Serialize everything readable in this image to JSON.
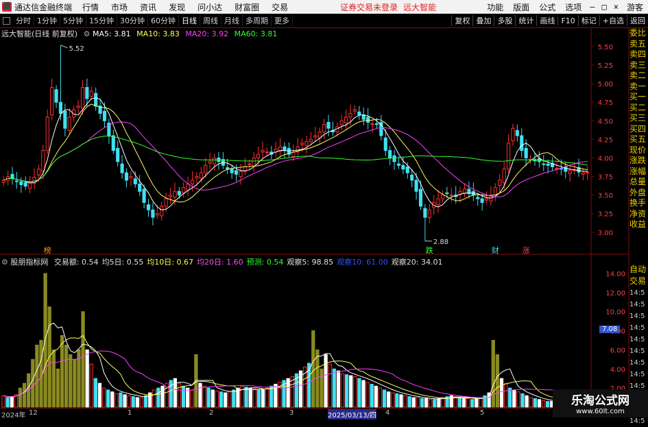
{
  "menubar": {
    "app_name": "通达信金融终端",
    "items": [
      "行情",
      "市场",
      "资讯",
      "发现",
      "问小达",
      "财富圈",
      "交易"
    ],
    "warning": "证券交易未登录",
    "stock_name": "远大智能",
    "right_items": [
      "功能",
      "版面",
      "公式",
      "选项"
    ],
    "user": "游客"
  },
  "toolbar": {
    "periods": [
      "分时",
      "1分钟",
      "5分钟",
      "15分钟",
      "30分钟",
      "60分钟",
      "日线",
      "周线",
      "月线",
      "多周期",
      "更多"
    ],
    "active_period": "日线",
    "right_buttons": [
      "复权",
      "叠加",
      "多股",
      "统计",
      "画线",
      "F10",
      "标记",
      "+自选",
      "返回"
    ]
  },
  "price_header": {
    "title": "远大智能(日线 前复权)",
    "ma5": "MA5: 3.81",
    "ma10": "MA10: 3.83",
    "ma20": "MA20: 3.92",
    "ma60": "MA60: 3.81"
  },
  "volume_header": {
    "title": "股朋指标网",
    "items": [
      {
        "text": "交易额: 0.54",
        "color": "#e0e0e0"
      },
      {
        "text": "均5日: 0.55",
        "color": "#e0e0e0"
      },
      {
        "text": "均10日: 0.67",
        "color": "#ffff60"
      },
      {
        "text": "均20日: 1.60",
        "color": "#ff50ff"
      },
      {
        "text": "预测: 0.54",
        "color": "#30ff30"
      },
      {
        "text": "观察5: 98.85",
        "color": "#e0e0e0"
      },
      {
        "text": "观察10: 61.00",
        "color": "#3050ff"
      },
      {
        "text": "观察20: 34.01",
        "color": "#e0e0e0"
      }
    ]
  },
  "sidebar": [
    "委比",
    "卖五",
    "卖四",
    "卖三",
    "卖二",
    "卖一",
    "买一",
    "买二",
    "买三",
    "买四",
    "买五",
    "现价",
    "涨跌",
    "涨幅",
    "总量",
    "外盘",
    "换手",
    "净资",
    "收益"
  ],
  "sidebar2": [
    "自动",
    "交易"
  ],
  "sidebar2_times": [
    "14:5",
    "14:5",
    "14:5",
    "14:5",
    "14:5",
    "14:5",
    "14:5",
    "14:5",
    "14:5",
    "14:5",
    "14:5",
    "14:5"
  ],
  "colors": {
    "up": "#ff3030",
    "down": "#40e0f0",
    "ma5": "#ffffff",
    "ma10": "#ffff60",
    "ma20": "#ff40ff",
    "ma60": "#30ff30",
    "olive": "#8a8a20"
  },
  "watermark": {
    "line1": "乐淘公式网",
    "line2": "www.60lt.com"
  },
  "price_badge": "7.08",
  "markers": [
    {
      "text": "榜",
      "color": "#ff9a00"
    },
    {
      "text": "跌",
      "color": "#40ff40"
    },
    {
      "text": "财",
      "color": "#40e0f0"
    },
    {
      "text": "涨",
      "color": "#ff4040"
    }
  ],
  "annotations": {
    "high": "5.52",
    "low": "2.88"
  },
  "chart_data": [
    {
      "type": "candlestick",
      "yticks": [
        3.0,
        3.25,
        3.5,
        3.75,
        4.0,
        4.25,
        4.5,
        4.75,
        5.0,
        5.25,
        5.5
      ],
      "ylim": [
        2.85,
        5.62
      ],
      "closes": [
        3.7,
        3.75,
        3.72,
        3.68,
        3.64,
        3.62,
        3.66,
        3.74,
        3.85,
        4.1,
        4.55,
        4.95,
        4.75,
        4.6,
        4.4,
        4.55,
        4.65,
        4.7,
        4.95,
        4.8,
        4.9,
        4.7,
        4.6,
        4.5,
        4.3,
        4.1,
        3.95,
        3.8,
        3.7,
        3.75,
        3.65,
        3.55,
        3.4,
        3.3,
        3.2,
        3.25,
        3.35,
        3.45,
        3.5,
        3.55,
        3.5,
        3.6,
        3.65,
        3.7,
        3.75,
        3.8,
        3.9,
        3.95,
        4.0,
        3.95,
        3.9,
        3.85,
        3.8,
        3.78,
        3.82,
        3.88,
        3.92,
        4.0,
        4.05,
        4.1,
        4.08,
        4.05,
        4.12,
        4.15,
        4.1,
        4.05,
        4.08,
        4.15,
        4.2,
        4.22,
        4.25,
        4.3,
        4.35,
        4.45,
        4.4,
        4.35,
        4.42,
        4.5,
        4.55,
        4.6,
        4.65,
        4.58,
        4.52,
        4.48,
        4.46,
        4.45,
        4.3,
        4.1,
        4.0,
        3.95,
        3.9,
        3.85,
        3.8,
        3.7,
        3.55,
        3.35,
        3.2,
        3.3,
        3.4,
        3.45,
        3.5,
        3.52,
        3.5,
        3.48,
        3.55,
        3.58,
        3.52,
        3.5,
        3.45,
        3.4,
        3.45,
        3.5,
        3.6,
        3.7,
        3.85,
        4.2,
        4.4,
        4.3,
        4.1,
        4.0,
        3.98,
        3.96,
        3.95,
        3.92,
        3.9,
        3.88,
        3.86,
        3.85,
        3.82,
        3.83,
        3.84,
        3.81,
        3.8,
        3.81
      ],
      "high": 5.52,
      "low": 2.88
    },
    {
      "type": "bar",
      "yticks": [
        2.0,
        4.0,
        6.0,
        8.0,
        10.0,
        12.0,
        14.0
      ],
      "ylim": [
        0,
        15
      ],
      "values": [
        1.2,
        1.0,
        1.1,
        1.3,
        2.0,
        2.5,
        3.5,
        5.0,
        6.5,
        7.0,
        14.0,
        10.5,
        6.0,
        4.0,
        7.5,
        6.5,
        5.5,
        5.0,
        6.0,
        10.0,
        6.0,
        4.5,
        3.0,
        2.5,
        2.0,
        1.8,
        1.6,
        1.4,
        1.5,
        1.3,
        1.2,
        1.1,
        1.0,
        1.0,
        1.2,
        1.5,
        1.8,
        2.0,
        2.2,
        2.5,
        2.8,
        3.0,
        2.5,
        2.2,
        2.0,
        1.8,
        5.5,
        2.5,
        2.2,
        2.0,
        1.8,
        1.7,
        1.6,
        1.5,
        1.6,
        1.8,
        2.0,
        2.2,
        2.1,
        2.0,
        1.9,
        1.8,
        1.8,
        2.0,
        2.2,
        2.4,
        2.6,
        2.8,
        3.0,
        3.2,
        3.5,
        3.8,
        4.2,
        4.6,
        8.0,
        6.0,
        4.0,
        5.5,
        4.5,
        4.0,
        3.8,
        3.5,
        3.4,
        3.3,
        3.2,
        3.0,
        2.8,
        2.6,
        2.4,
        2.2,
        2.0,
        1.8,
        1.6,
        1.5,
        1.4,
        1.3,
        1.2,
        1.1,
        1.0,
        1.0,
        0.9,
        0.9,
        0.8,
        0.8,
        0.9,
        1.0,
        1.1,
        1.2,
        1.1,
        1.0,
        0.9,
        0.9,
        0.8,
        0.9,
        1.0,
        1.2,
        1.5,
        7.0,
        5.5,
        3.0,
        2.5,
        2.0,
        1.8,
        1.6,
        1.4,
        1.2,
        1.0,
        0.9,
        0.8,
        0.7,
        0.6,
        0.6,
        0.55,
        0.54
      ],
      "olive_indices": [
        4,
        5,
        6,
        7,
        8,
        9,
        10,
        11,
        12,
        13,
        14,
        15,
        16,
        17,
        18,
        19,
        46,
        74,
        75,
        76,
        117,
        118
      ]
    }
  ],
  "xaxis": [
    {
      "label": "2024年",
      "color": "#c0c0c0"
    },
    {
      "label": "12",
      "color": "#c0c0c0"
    },
    {
      "label": "1",
      "color": "#c0c0c0"
    },
    {
      "label": "2",
      "color": "#c0c0c0"
    },
    {
      "label": "3",
      "color": "#c0c0c0"
    },
    {
      "label": "2025/03/13/四",
      "color": "#ffffff"
    },
    {
      "label": "4",
      "color": "#c0c0c0"
    },
    {
      "label": "5",
      "color": "#c0c0c0"
    }
  ]
}
